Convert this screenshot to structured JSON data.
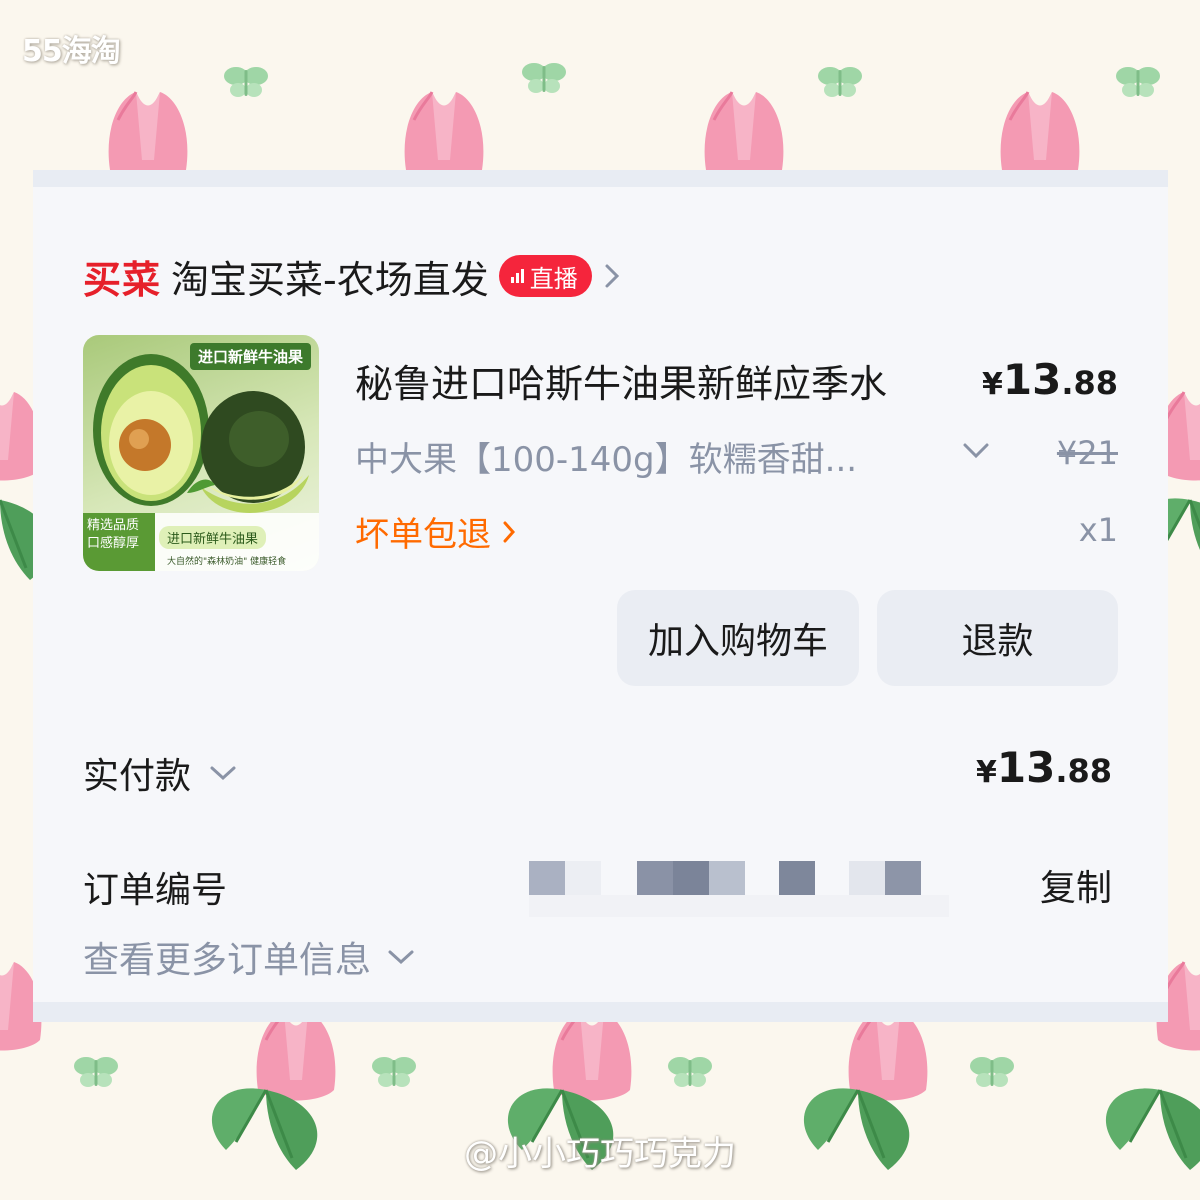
{
  "watermark_top": "55海淘",
  "watermark_bottom": "@小小巧巧巧克力",
  "shop": {
    "logo_text": "买菜",
    "name": "淘宝买菜-农场直发",
    "live_badge": "直播"
  },
  "item": {
    "image_top_label": "进口新鲜牛油果",
    "image_side_line1": "精选品质",
    "image_side_line2": "口感醇厚",
    "image_pill": "进口新鲜牛油果",
    "image_small_text": "大自然的\"森林奶油\" 健康轻食",
    "title": "秘鲁进口哈斯牛油果新鲜应季水",
    "price_symbol": "¥",
    "price_integer": "13",
    "price_decimal": ".88",
    "sku": "中大果【100-140g】软糯香甜...",
    "original_price": "¥21",
    "guarantee": "坏单包退",
    "quantity": "x1"
  },
  "actions": {
    "add_to_cart": "加入购物车",
    "refund": "退款"
  },
  "payment": {
    "label": "实付款",
    "symbol": "¥",
    "integer": "13",
    "decimal": ".88"
  },
  "order": {
    "label": "订单编号",
    "copy": "复制",
    "more_info": "查看更多订单信息"
  },
  "colors": {
    "brand_red": "#e6202a",
    "live_red": "#f5253c",
    "guarantee_orange": "#ff6a00",
    "muted_text": "#8a93a6"
  },
  "icons": {
    "live": "signal-bars-icon",
    "shop_arrow": "chevron-right-icon",
    "sku_dropdown": "chevron-down-icon",
    "guarantee_arrow": "chevron-right-icon",
    "paid_dropdown": "chevron-down-icon",
    "more_info_dropdown": "chevron-down-icon"
  }
}
